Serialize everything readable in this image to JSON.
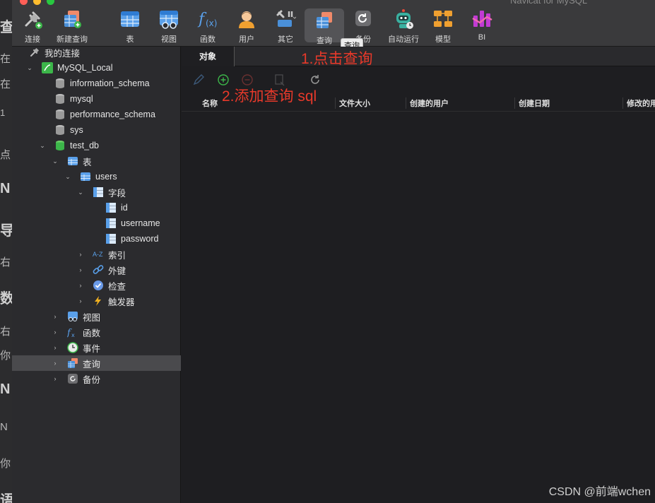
{
  "window": {
    "title": "Navicat for MySQL"
  },
  "background_fragments": [
    "查",
    "在",
    "在",
    "1",
    "点",
    "N",
    "导",
    "右",
    "数",
    "右",
    "你",
    "N",
    "N",
    "你",
    "语"
  ],
  "toolbar": {
    "buttons": [
      {
        "label": "连接",
        "icon": "plug-icon"
      },
      {
        "label": "新建查询",
        "icon": "new-query-icon"
      },
      {
        "label": "表",
        "icon": "table-icon"
      },
      {
        "label": "视图",
        "icon": "view-icon"
      },
      {
        "label": "函数",
        "icon": "function-icon"
      },
      {
        "label": "用户",
        "icon": "user-icon"
      },
      {
        "label": "其它",
        "icon": "tools-icon"
      },
      {
        "label": "查询",
        "icon": "query-icon"
      },
      {
        "label": "备份",
        "icon": "backup-icon"
      },
      {
        "label": "自动运行",
        "icon": "robot-icon"
      },
      {
        "label": "模型",
        "icon": "model-icon"
      },
      {
        "label": "BI",
        "icon": "bi-icon"
      }
    ],
    "tooltip": "查询"
  },
  "sidebar": {
    "header": "我的连接",
    "connection": "MySQL_Local",
    "databases": [
      "information_schema",
      "mysql",
      "performance_schema",
      "sys",
      "test_db"
    ],
    "test_db": {
      "tables_label": "表",
      "table": "users",
      "fields_label": "字段",
      "fields": [
        "id",
        "username",
        "password"
      ],
      "index_label": "索引",
      "foreign_key_label": "外键",
      "check_label": "检查",
      "trigger_label": "触发器",
      "views_label": "视图",
      "functions_label": "函数",
      "events_label": "事件",
      "queries_label": "查询",
      "backups_label": "备份"
    }
  },
  "main": {
    "tab": "对象",
    "columns": [
      "名称",
      "文件大小",
      "创建的用户",
      "创建日期",
      "修改的用户"
    ]
  },
  "annotations": {
    "step1": "1.点击查询",
    "step2": "2.添加查询 sql"
  },
  "watermark": "CSDN @前端wchen",
  "colors": {
    "annotation": "#e8392a",
    "toolbar_bg": "#3a3a3c",
    "sidebar_bg": "#2b2b2e",
    "main_bg": "#1e1e21"
  }
}
